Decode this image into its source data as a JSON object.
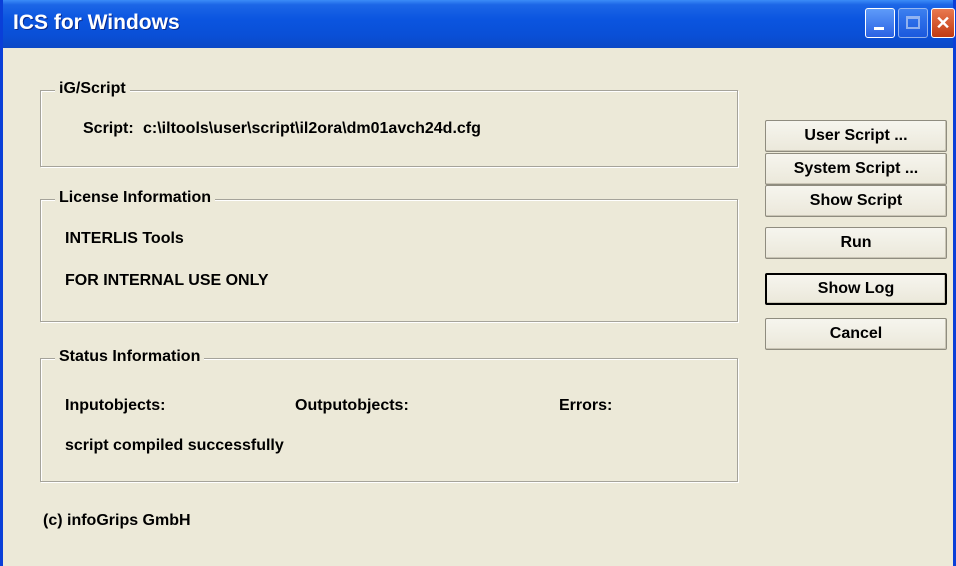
{
  "window": {
    "title": "ICS for Windows",
    "controls": {
      "minimize": "minimize-icon",
      "maximize": "maximize-icon",
      "close": "close-icon"
    }
  },
  "script_group": {
    "legend": "iG/Script",
    "script_label": "Script:",
    "script_path": "c:\\iltools\\user\\script\\il2ora\\dm01avch24d.cfg"
  },
  "license_group": {
    "legend": "License Information",
    "line1": "INTERLIS Tools",
    "line2": "FOR INTERNAL USE ONLY"
  },
  "status_group": {
    "legend": "Status Information",
    "input_label": "Inputobjects:",
    "output_label": "Outputobjects:",
    "errors_label": "Errors:",
    "message": "script compiled successfully"
  },
  "buttons": {
    "user_script": "User Script ...",
    "system_script": "System Script ...",
    "show_script": "Show Script",
    "run": "Run",
    "show_log": "Show Log",
    "cancel": "Cancel"
  },
  "footer": {
    "copyright": "(c) infoGrips GmbH"
  },
  "colors": {
    "titlebar": "#0a4fd6",
    "dialog_bg": "#ece9d8",
    "close_button": "#c13a12"
  }
}
